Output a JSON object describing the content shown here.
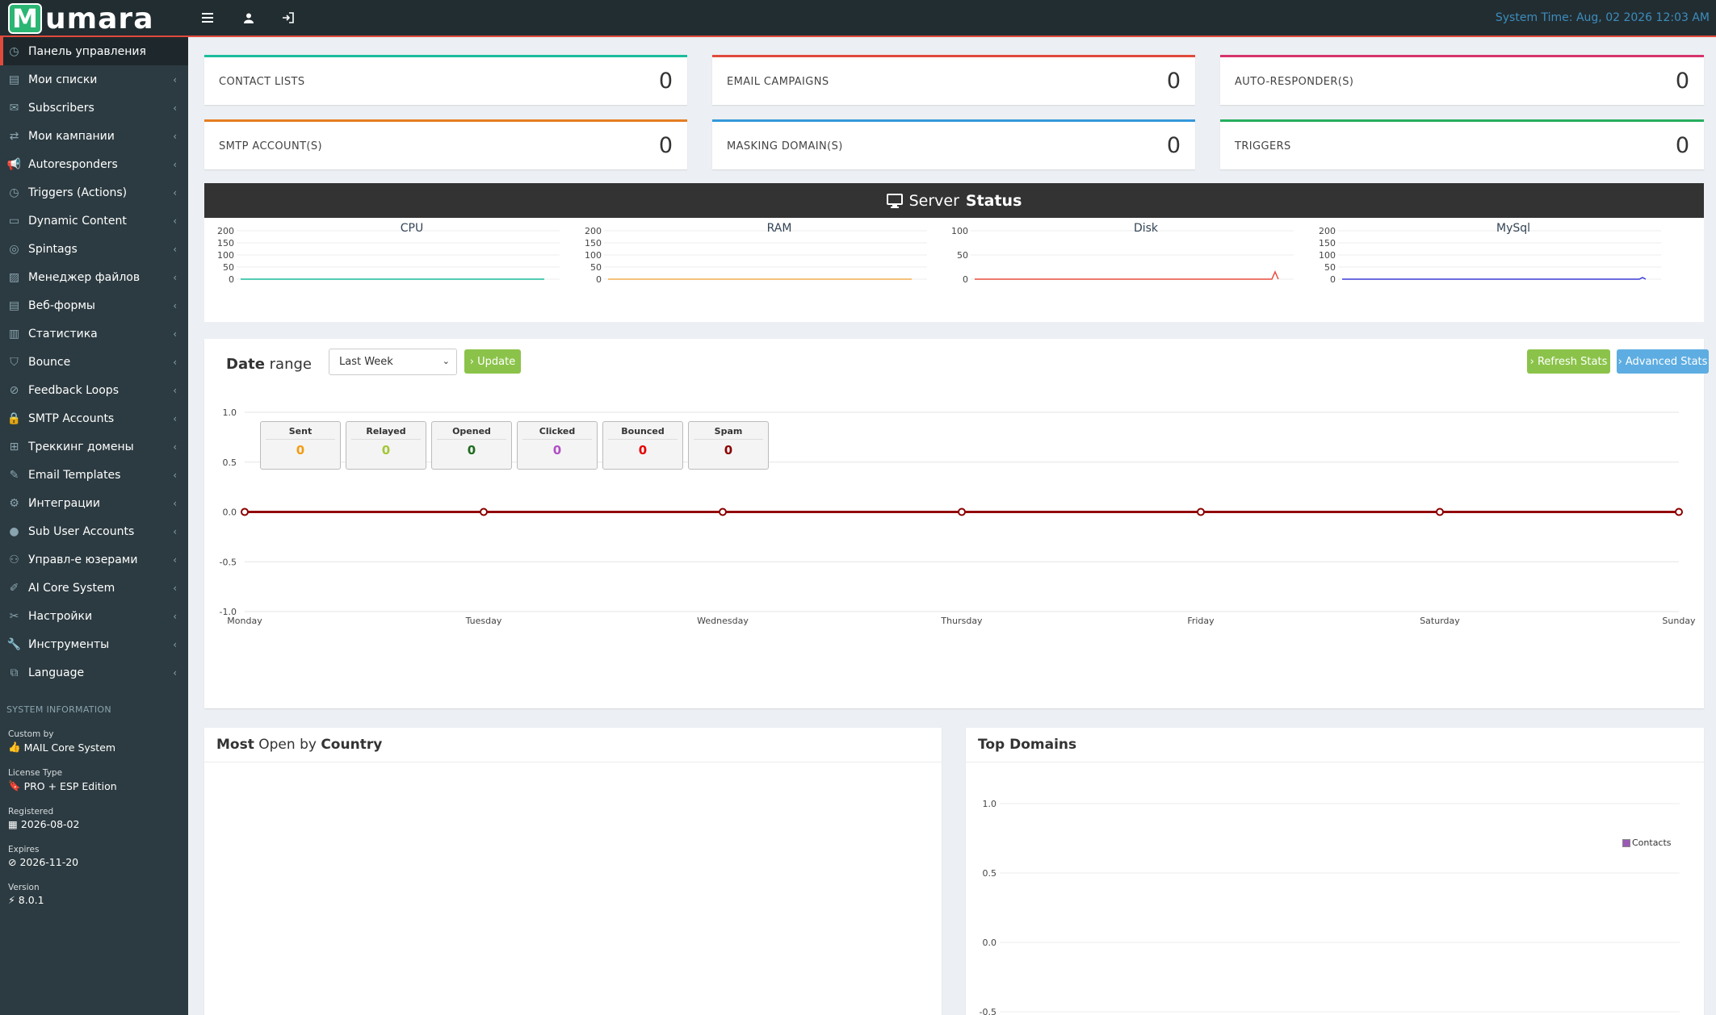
{
  "topbar": {
    "logo_letter": "M",
    "logo_text": "umara",
    "system_time": "System Time: Aug, 02 2026 12:03 AM",
    "icons": [
      "menu-icon",
      "user-icon",
      "logout-icon"
    ]
  },
  "sidebar": {
    "items": [
      {
        "label": "Панель управления",
        "icon": "dashboard-icon",
        "active": true
      },
      {
        "label": "Мои списки",
        "icon": "list-icon"
      },
      {
        "label": "Subscribers",
        "icon": "subscribers-icon"
      },
      {
        "label": "Мои кампании",
        "icon": "campaign-icon"
      },
      {
        "label": "Autoresponders",
        "icon": "megaphone-icon"
      },
      {
        "label": "Triggers (Actions)",
        "icon": "clock-icon"
      },
      {
        "label": "Dynamic Content",
        "icon": "content-icon"
      },
      {
        "label": "Spintags",
        "icon": "spin-icon"
      },
      {
        "label": "Менеджер файлов",
        "icon": "image-icon"
      },
      {
        "label": "Веб-формы",
        "icon": "form-icon"
      },
      {
        "label": "Статистика",
        "icon": "chart-icon"
      },
      {
        "label": "Bounce",
        "icon": "bounce-icon"
      },
      {
        "label": "Feedback Loops",
        "icon": "feedback-icon"
      },
      {
        "label": "SMTP Accounts",
        "icon": "lock-icon"
      },
      {
        "label": "Треккинг домены",
        "icon": "sitemap-icon"
      },
      {
        "label": "Email Templates",
        "icon": "pencil-icon"
      },
      {
        "label": "Интеграции",
        "icon": "cogs-icon"
      },
      {
        "label": "Sub User Accounts",
        "icon": "user-icon"
      },
      {
        "label": "Управл-е юзерами",
        "icon": "users-icon"
      },
      {
        "label": "AI Core System",
        "icon": "magic-icon"
      },
      {
        "label": "Настройки",
        "icon": "tools-icon"
      },
      {
        "label": "Инструменты",
        "icon": "wrench-icon"
      },
      {
        "label": "Language",
        "icon": "language-icon"
      }
    ],
    "system_info": {
      "heading": "SYSTEM INFORMATION",
      "custom_by_label": "Custom by",
      "custom_by": "MAIL Core System",
      "license_label": "License Type",
      "license": "PRO + ESP Edition",
      "registered_label": "Registered",
      "registered": "2026-08-02",
      "expires_label": "Expires",
      "expires": "2026-11-20",
      "version_label": "Version",
      "version": "8.0.1"
    }
  },
  "stats": [
    {
      "label": "CONTACT LISTS",
      "value": "0",
      "color": "#1abc9c"
    },
    {
      "label": "EMAIL CAMPAIGNS",
      "value": "0",
      "color": "#e04b3c"
    },
    {
      "label": "AUTO-RESPONDER(S)",
      "value": "0",
      "color": "#d6336c"
    },
    {
      "label": "SMTP ACCOUNT(S)",
      "value": "0",
      "color": "#e67e22"
    },
    {
      "label": "MASKING DOMAIN(S)",
      "value": "0",
      "color": "#3498db"
    },
    {
      "label": "TRIGGERS",
      "value": "0",
      "color": "#27ae60"
    }
  ],
  "server_status": {
    "title_light": "Server",
    "title_bold": "Status",
    "charts": [
      {
        "name": "CPU",
        "ticks": [
          "200",
          "150",
          "100",
          "50",
          "0"
        ],
        "color": "#1abc9c"
      },
      {
        "name": "RAM",
        "ticks": [
          "200",
          "150",
          "100",
          "50",
          "0"
        ],
        "color": "#f0ad4e"
      },
      {
        "name": "Disk",
        "ticks": [
          "100",
          "50",
          "0"
        ],
        "color": "#e74c3c"
      },
      {
        "name": "MySql",
        "ticks": [
          "200",
          "150",
          "100",
          "50",
          "0"
        ],
        "color": "#3b3bd6"
      }
    ]
  },
  "date_range": {
    "title_bold": "Date",
    "title_light": "range",
    "select_value": "Last Week",
    "update_label": "› Update",
    "refresh_label": "› Refresh Stats",
    "advanced_label": "› Advanced Stats"
  },
  "legend": [
    {
      "label": "Sent",
      "value": "0",
      "color": "#f39c12"
    },
    {
      "label": "Relayed",
      "value": "0",
      "color": "#a4c639"
    },
    {
      "label": "Opened",
      "value": "0",
      "color": "#1e6b1e"
    },
    {
      "label": "Clicked",
      "value": "0",
      "color": "#b04fc4"
    },
    {
      "label": "Bounced",
      "value": "0",
      "color": "#e60000"
    },
    {
      "label": "Spam",
      "value": "0",
      "color": "#8b0000"
    }
  ],
  "chart_data": [
    {
      "type": "line",
      "categories": [
        "Monday",
        "Tuesday",
        "Wednesday",
        "Thursday",
        "Friday",
        "Saturday",
        "Sunday"
      ],
      "series": [
        {
          "name": "Sent",
          "values": [
            0,
            0,
            0,
            0,
            0,
            0,
            0
          ]
        },
        {
          "name": "Relayed",
          "values": [
            0,
            0,
            0,
            0,
            0,
            0,
            0
          ]
        },
        {
          "name": "Opened",
          "values": [
            0,
            0,
            0,
            0,
            0,
            0,
            0
          ]
        },
        {
          "name": "Clicked",
          "values": [
            0,
            0,
            0,
            0,
            0,
            0,
            0
          ]
        },
        {
          "name": "Bounced",
          "values": [
            0,
            0,
            0,
            0,
            0,
            0,
            0
          ]
        },
        {
          "name": "Spam",
          "values": [
            0,
            0,
            0,
            0,
            0,
            0,
            0
          ]
        }
      ],
      "yticks": [
        "1.0",
        "0.5",
        "0.0",
        "-0.5",
        "-1.0"
      ],
      "ylim": [
        -1,
        1
      ]
    },
    {
      "type": "bar",
      "title": "Top Domains",
      "series": [
        {
          "name": "Contacts",
          "values": []
        }
      ],
      "yticks": [
        "1.0",
        "0.5",
        "0.0",
        "-0.5"
      ]
    }
  ],
  "panels": {
    "country_title_1": "Most",
    "country_title_2": "Open",
    "country_title_3": "by",
    "country_title_4": "Country",
    "domains_title": "Top Domains",
    "domains_legend": "Contacts",
    "domains_legend_color": "#9b59b6"
  }
}
